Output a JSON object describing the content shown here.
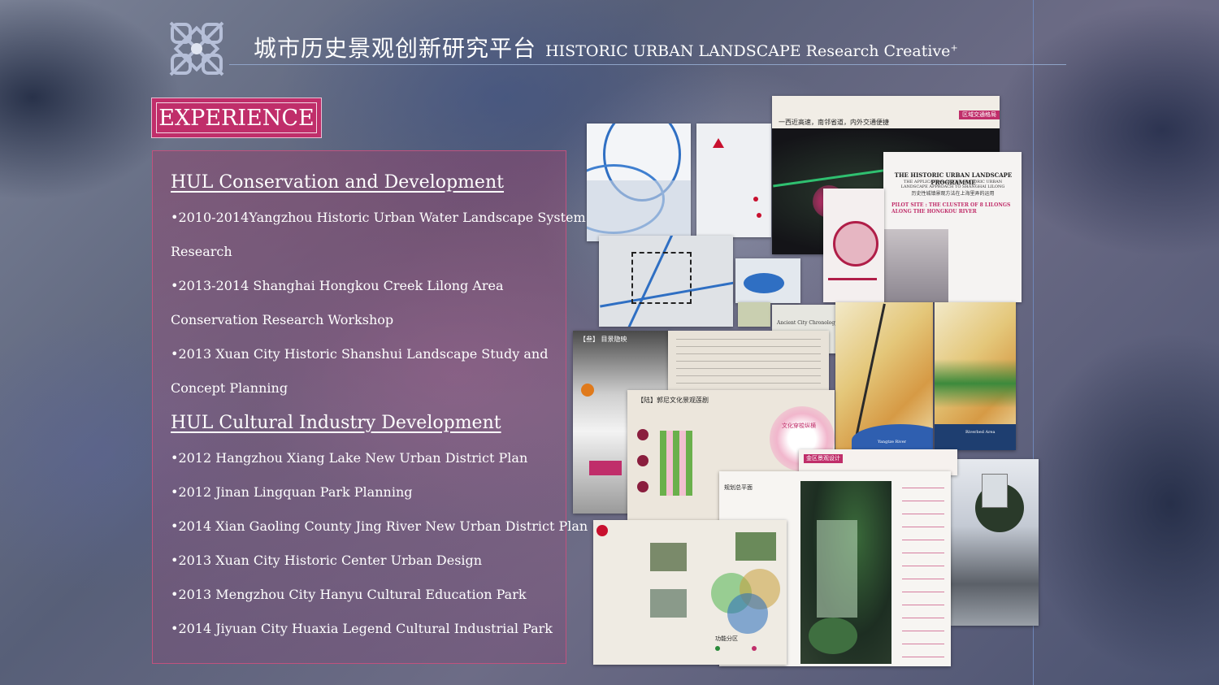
{
  "header": {
    "title_cn": "城市历史景观创新研究平台",
    "title_en": "HISTORIC URBAN LANDSCAPE Research Creative",
    "title_sup": "+"
  },
  "badge": {
    "label": "EXPERIENCE"
  },
  "sections": [
    {
      "title": "HUL Conservation and Development",
      "items": [
        "•2010-2014Yangzhou Historic Urban Water Landscape System",
        "Research",
        "•2013-2014 Shanghai Hongkou Creek Lilong Area",
        "Conservation Research Workshop",
        "•2013 Xuan City Historic Shanshui Landscape Study and",
        "Concept Planning"
      ]
    },
    {
      "title": "HUL Cultural Industry Development",
      "items": [
        "•2012 Hangzhou Xiang Lake New Urban District Plan",
        "•2012 Jinan Lingquan Park Planning",
        "•2014 Xian Gaoling County Jing River New Urban  District Plan",
        "•2013 Xuan City Historic Center Urban  Design",
        "•2013 Mengzhou City Hanyu Cultural Education Park",
        "•2014 Jiyuan City Huaxia Legend Cultural Industrial Park"
      ]
    }
  ],
  "collage": {
    "dark_map_heading": "一西近高速，南邻省道，内外交通便捷",
    "dark_map_tag": "区域交通格局",
    "programme_title": "THE HISTORIC URBAN LANDSCAPE PROGRAMME",
    "programme_subtitle": "THE APPLICATION OF THE HISTORIC URBAN LANDSCAPE APPROACH TO SHANGHAI LILONG",
    "programme_cn": "历史性城镇景观方法在上海里弄的运用",
    "pilot_site": "PILOT SITE : THE CLUSTER OF 8 LILONGS ALONG THE HONGKOU RIVER",
    "ancient_chronology": "Ancient City Chronology",
    "yangtze_river": "Yangtze River",
    "riverbed_area": "Riverbed Area",
    "poster_heading_1": "【叁】 目景隐映",
    "poster_heading_2": "【陆】郭尼文化景观莲剧",
    "poster_sub": "文化穿梭纵横",
    "plan_title": "规划总平面",
    "plan_tag": "金区景观设计",
    "legend_heading": "功能分区"
  }
}
